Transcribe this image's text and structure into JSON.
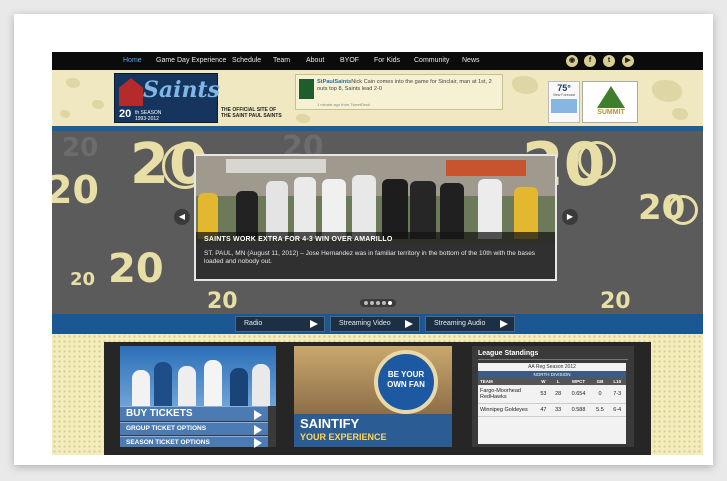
{
  "nav": {
    "items": [
      "Home",
      "Game Day Experience",
      "Schedule",
      "Team",
      "About",
      "BYOF",
      "For Kids",
      "Community",
      "News"
    ],
    "social": [
      "rss-icon",
      "facebook-icon",
      "twitter-icon",
      "youtube-icon"
    ]
  },
  "header": {
    "logo_script": "Saints",
    "logo_years": "20",
    "logo_years_suffix": "th SEASON",
    "logo_range": "1993-2012",
    "official_line1": "THE OFFICIAL SITE OF",
    "official_line2": "THE SAINT PAUL SAINTS",
    "tweet_handle": "StPaulSaints",
    "tweet_text": "Nick Cain comes into the game for Sinclair, man at 1st, 2 outs top 8, Saints lead 2-0",
    "tweet_meta": "1 minute ago from TweetDeck",
    "weather_temp": "75°",
    "weather_label": "View Forecast",
    "sponsor_name": "SUMMIT"
  },
  "hero": {
    "headline": "SAINTS WORK EXTRA FOR 4-3 WIN OVER AMARILLO",
    "body": "ST. PAUL, MN (August 11, 2012) – Jose Hernandez was in familiar territory in the bottom of the 10th with the bases loaded and nobody out.",
    "prev_label": "◀",
    "next_label": "▶",
    "slide_count": 5,
    "active_slide": 5
  },
  "audio": {
    "buttons": [
      "Radio",
      "Streaming Video",
      "Streaming Audio"
    ]
  },
  "tickets": {
    "buy": "BUY TICKETS",
    "group": "GROUP TICKET OPTIONS",
    "season": "SEASON TICKET OPTIONS"
  },
  "saintify": {
    "badge": "BE YOUR OWN FAN",
    "title": "SAINTIFY",
    "subtitle": "YOUR EXPERIENCE"
  },
  "standings": {
    "title": "League Standings",
    "season": "AA Reg Season 2012",
    "division": "NORTH DIVISION",
    "columns": [
      "TEAM",
      "W",
      "L",
      "WPCT",
      "GB",
      "L10"
    ],
    "rows": [
      [
        "Fargo-Moorhead RedHawks",
        "53",
        "28",
        "0.654",
        "0",
        "7-3"
      ],
      [
        "Winnipeg Goldeyes",
        "47",
        "33",
        "0.588",
        "5.5",
        "6-4"
      ]
    ]
  },
  "colors": {
    "nav_bg": "#0b0b0b",
    "nav_active": "#5fa8e8",
    "accent_blue": "#1f5d96",
    "cream": "#efe8c0",
    "hero_gray": "#5b5b5b"
  }
}
